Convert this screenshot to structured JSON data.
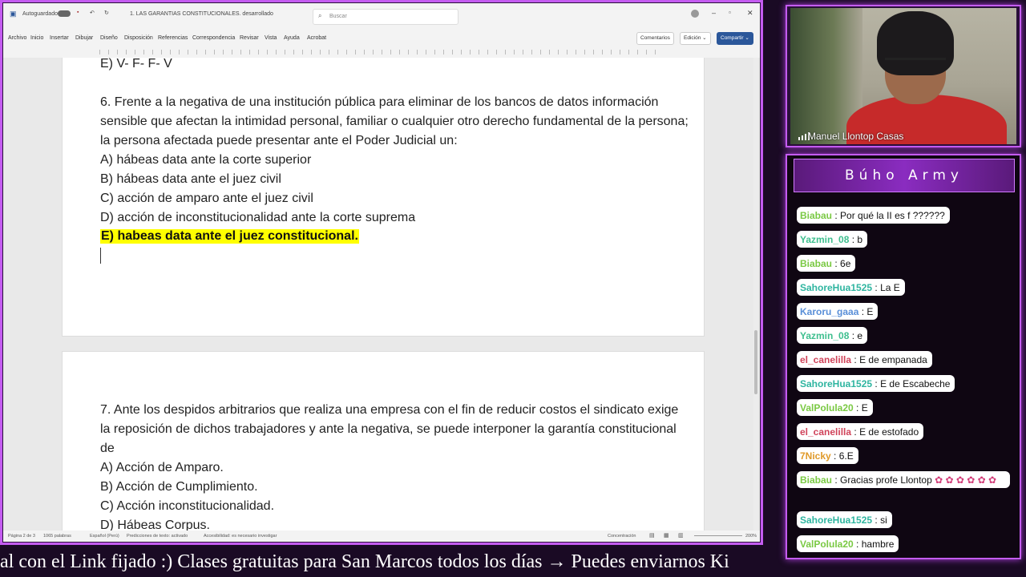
{
  "word": {
    "titlebar": {
      "autosave_label": "Autoguardado",
      "doc_title": "1. LAS GARANTIAS CONSTITUCIONALES. desarrollado",
      "search_placeholder": "Buscar"
    },
    "menu": [
      "Archivo",
      "Inicio",
      "Insertar",
      "Dibujar",
      "Diseño",
      "Disposición",
      "Referencias",
      "Correspondencia",
      "Revisar",
      "Vista",
      "Ayuda",
      "Acrobat"
    ],
    "buttons": {
      "comments": "Comentarios",
      "editing": "Edición",
      "share": "Compartir"
    },
    "page1_lines": [
      "E) V- F- F- V",
      "6. Frente a la negativa de una institución pública para eliminar de los bancos de datos información",
      "sensible que afectan la intimidad personal, familiar o cualquier otro derecho fundamental de la persona;",
      "la persona afectada puede presentar ante el Poder Judicial un:",
      "A) hábeas data ante la corte superior",
      "B) hábeas data ante el juez civil",
      "C) acción de amparo ante el juez civil",
      "D) acción de inconstitucionalidad ante la corte suprema",
      "E) habeas data ante el juez constitucional."
    ],
    "page2_lines": [
      "7. Ante los despidos arbitrarios que realiza una empresa con el fin de reducir costos el sindicato exige",
      "la reposición de dichos trabajadores y ante la negativa, se puede interponer la garantía constitucional",
      "de",
      "A) Acción de Amparo.",
      "B) Acción de Cumplimiento.",
      "C) Acción inconstitucionalidad.",
      "D) Hábeas Corpus."
    ],
    "status": {
      "page": "Página 2 de 3",
      "words": "1065 palabras",
      "language": "Español (Perú)",
      "predictions": "Predicciones de texto: activado",
      "accessibility": "Accesibilidad: es necesario investigar",
      "focus": "Concentración",
      "zoom": "200%"
    }
  },
  "webcam": {
    "name": "Manuel Llontop Casas"
  },
  "chat": {
    "title": "Búho Army",
    "messages": [
      {
        "user": "Biabau",
        "text": "Por qué la II es f ??????",
        "color": "#7ac943"
      },
      {
        "user": "Yazmin_08",
        "text": "b",
        "color": "#3fbf8f"
      },
      {
        "user": "Biabau",
        "text": "6e",
        "color": "#7ac943"
      },
      {
        "user": "SahoreHua1525",
        "text": "La E",
        "color": "#2fb5a0"
      },
      {
        "user": "Karoru_gaaa",
        "text": "E",
        "color": "#5a8fd8"
      },
      {
        "user": "Yazmin_08",
        "text": "e",
        "color": "#3fbf8f"
      },
      {
        "user": "el_canelilla",
        "text": "E de empanada",
        "color": "#d0435a"
      },
      {
        "user": "SahoreHua1525",
        "text": "E de Escabeche",
        "color": "#2fb5a0"
      },
      {
        "user": "ValPolula20",
        "text": "E",
        "color": "#7ac943"
      },
      {
        "user": "el_canelilla",
        "text": "E de estofado",
        "color": "#d0435a"
      },
      {
        "user": "7Nicky",
        "text": "6.E",
        "color": "#e09a2a"
      },
      {
        "user": "Biabau",
        "text": "Gracias profe Llontop",
        "color": "#7ac943"
      },
      {
        "user": "SahoreHua1525",
        "text": "si",
        "color": "#2fb5a0"
      },
      {
        "user": "ValPolula20",
        "text": "hambre",
        "color": "#7ac943"
      }
    ]
  },
  "ticker": "al con el Link fijado :)  Clases gratuitas para San Marcos todos los días  →  Puedes enviarnos Ki"
}
